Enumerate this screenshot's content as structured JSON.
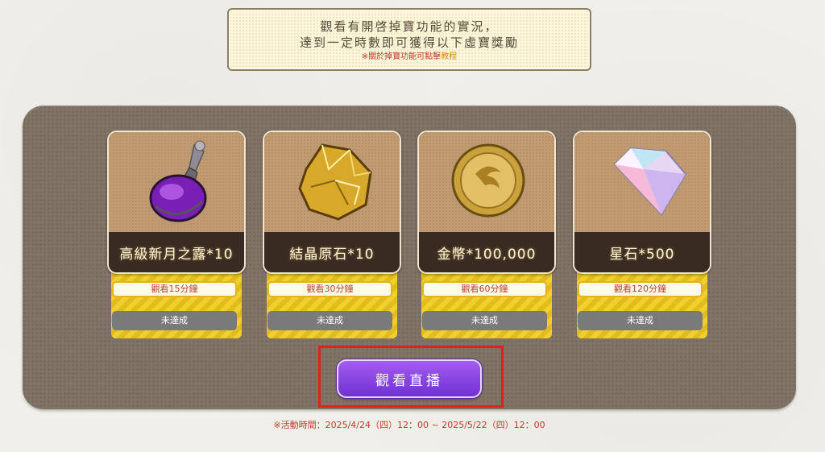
{
  "notice": {
    "line1": "觀看有開啓掉寶功能的實況，",
    "line2": "達到一定時數即可獲得以下虛寶獎勵",
    "note_prefix": "※關於掉寶功能可點擊",
    "note_link": "教程"
  },
  "rewards": [
    {
      "name": "高級新月之露*10",
      "requirement": "觀看15分鐘",
      "status": "未達成",
      "icon": "purple-potion-icon"
    },
    {
      "name": "結晶原石*10",
      "requirement": "觀看30分鐘",
      "status": "未達成",
      "icon": "gold-ore-icon"
    },
    {
      "name": "金幣*100,000",
      "requirement": "觀看60分鐘",
      "status": "未達成",
      "icon": "gold-coin-icon"
    },
    {
      "name": "星石*500",
      "requirement": "觀看120分鐘",
      "status": "未達成",
      "icon": "star-gem-icon"
    }
  ],
  "cta": {
    "label": "觀看直播"
  },
  "event_period": "※活動時間：2025/4/24（四）12：00 ~ 2025/5/22（四）12：00",
  "colors": {
    "accent_purple": "#8a45e3",
    "highlight_red": "#e0221c",
    "note_red": "#c0392b",
    "ribbon_yellow": "#f0cf2e"
  }
}
